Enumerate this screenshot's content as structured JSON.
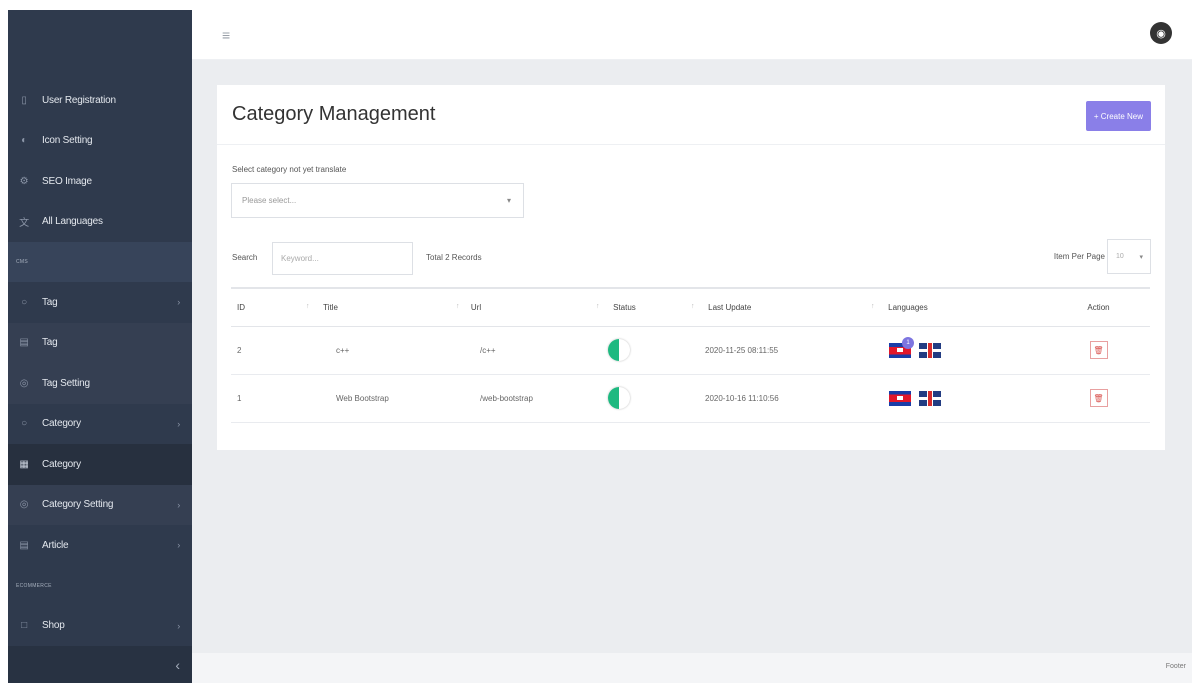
{
  "sidebar": {
    "items": [
      {
        "label": "User Registration",
        "icon": "user-icon"
      },
      {
        "label": "Icon Setting",
        "icon": "circle-icon"
      },
      {
        "label": "SEO Image",
        "icon": "gear-icon"
      },
      {
        "label": "All Languages",
        "icon": "language-icon"
      }
    ],
    "section_cms": "CMS",
    "cms_items": [
      {
        "label": "Tag",
        "icon": "tag-icon"
      },
      {
        "label": "Tag",
        "icon": "document-icon"
      },
      {
        "label": "Tag Setting",
        "icon": "gear-icon"
      },
      {
        "label": "Category",
        "icon": "circle-icon"
      },
      {
        "label": "Category",
        "icon": "list-icon"
      },
      {
        "label": "Category Setting",
        "icon": "gear-icon"
      },
      {
        "label": "Article",
        "icon": "document-icon"
      }
    ],
    "section_ecom": "ECOMMERCE",
    "ecom_items": [
      {
        "label": "Shop",
        "icon": "square-icon"
      }
    ],
    "collapse_icon": "‹"
  },
  "topbar": {
    "menu_icon": "≡",
    "user_icon": "◉"
  },
  "page": {
    "title": "Category Management",
    "create_label": "+ Create New",
    "select_label": "Select category not yet translate",
    "select_placeholder": "Please select...",
    "search_label": "Search",
    "search_placeholder": "Keyword...",
    "total_records": "Total 2 Records",
    "items_per_page_label": "Item Per Page",
    "items_per_page_value": "10"
  },
  "table": {
    "headers": [
      "ID",
      "Title",
      "Url",
      "Status",
      "Last Update",
      "Languages",
      "Action"
    ],
    "rows": [
      {
        "id": "2",
        "title": "c++",
        "url": "/c++",
        "status": "on",
        "last_update": "2020-11-25 08:11:55",
        "languages": [
          "kh",
          "uk"
        ],
        "badge": "1"
      },
      {
        "id": "1",
        "title": "Web Bootstrap",
        "url": "/web-bootstrap",
        "status": "on",
        "last_update": "2020-10-16 11:10:56",
        "languages": [
          "kh",
          "uk"
        ],
        "badge": ""
      }
    ]
  },
  "footer": {
    "text": "Footer"
  },
  "colors": {
    "sidebar_bg": "#2f3a4d",
    "accent": "#8a7fe8",
    "toggle_on": "#1eb980",
    "delete": "#d9534f"
  }
}
